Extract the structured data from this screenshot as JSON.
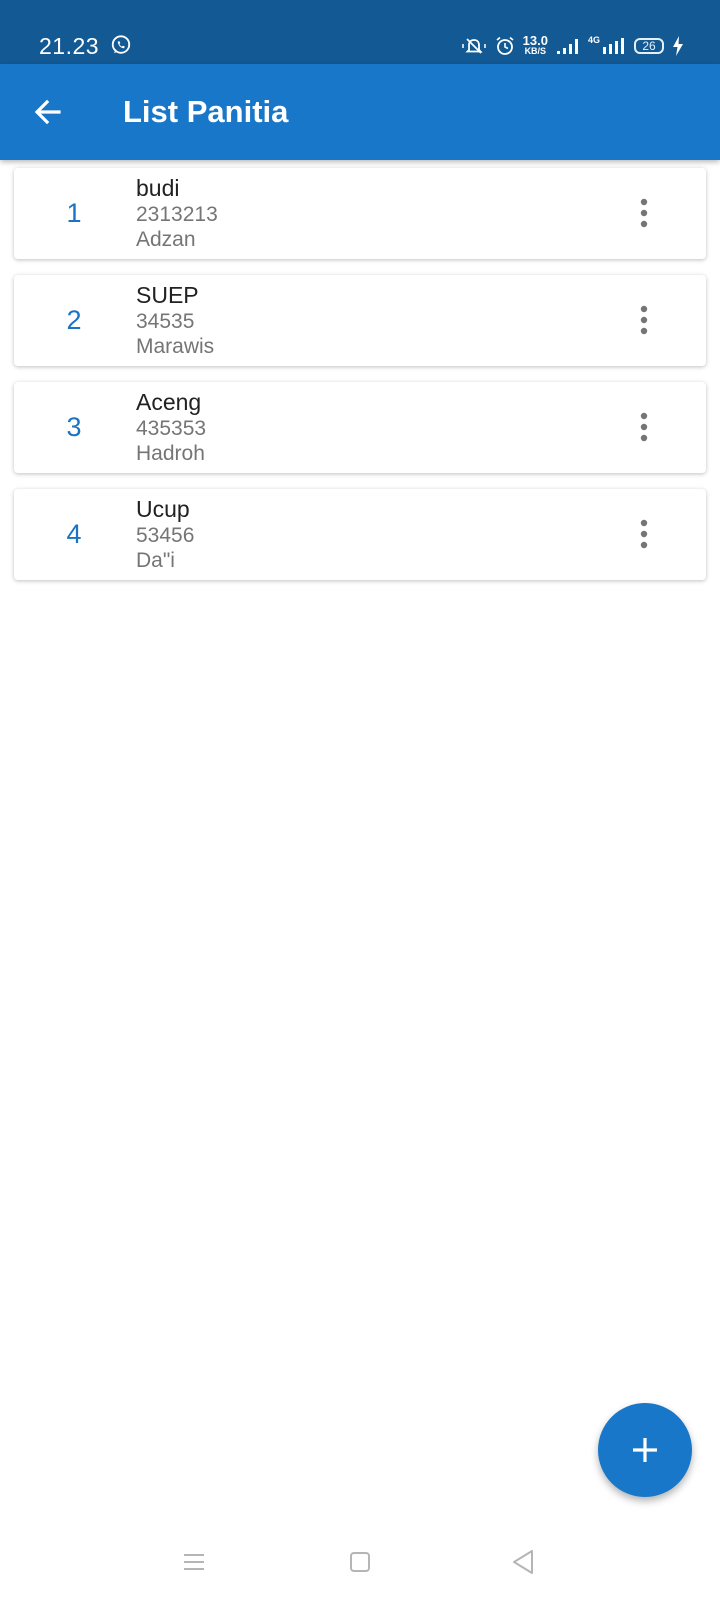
{
  "status_bar": {
    "time": "21.23",
    "net_speed_value": "13.0",
    "net_speed_unit": "KB/S",
    "net_type": "4G",
    "battery": "26",
    "icons": [
      "whatsapp-icon",
      "silent-icon",
      "alarm-icon",
      "signal-icon",
      "signal-4g-icon",
      "battery-icon",
      "charging-icon"
    ]
  },
  "app_bar": {
    "title": "List Panitia",
    "color": "#1877c9"
  },
  "items": [
    {
      "number": "1",
      "name": "budi",
      "phone": "2313213",
      "role": "Adzan"
    },
    {
      "number": "2",
      "name": "SUEP",
      "phone": "34535",
      "role": "Marawis"
    },
    {
      "number": "3",
      "name": "Aceng",
      "phone": "435353",
      "role": "Hadroh"
    },
    {
      "number": "4",
      "name": "Ucup",
      "phone": "53456",
      "role": "Da\"i"
    }
  ],
  "fab": {
    "icon": "plus-icon"
  },
  "nav": {
    "icons": [
      "menu-icon",
      "home-icon",
      "back-icon"
    ]
  }
}
